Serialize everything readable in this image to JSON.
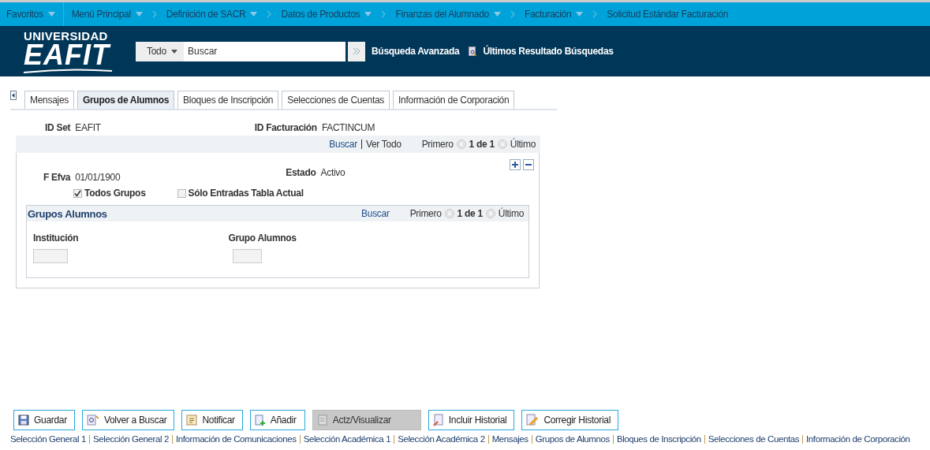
{
  "breadcrumb": [
    {
      "label": "Favoritos",
      "dropdown": true,
      "separator": false
    },
    {
      "label": "Menú Principal",
      "dropdown": true,
      "separator": false
    },
    {
      "label": "Definición de SACR",
      "dropdown": true,
      "separator": true
    },
    {
      "label": "Datos de Productos",
      "dropdown": true,
      "separator": true
    },
    {
      "label": "Finanzas del Alumnado",
      "dropdown": true,
      "separator": true
    },
    {
      "label": "Facturación",
      "dropdown": true,
      "separator": true
    },
    {
      "label": "Solicitud Estándar Facturación",
      "dropdown": false,
      "separator": true
    }
  ],
  "header": {
    "logo_top": "UNIVERSIDAD",
    "logo_main": "EAFIT",
    "scope": "Todo",
    "search_placeholder": "Buscar",
    "advanced_search": "Búsqueda Avanzada",
    "recent_results": "Últimos Resultado Búsquedas"
  },
  "tabs": [
    {
      "label": "Mensajes",
      "selected": false
    },
    {
      "label": "Grupos de Alumnos",
      "selected": true
    },
    {
      "label": "Bloques de Inscripción",
      "selected": false
    },
    {
      "label": "Selecciones de Cuentas",
      "selected": false
    },
    {
      "label": "Información de Corporación",
      "selected": false
    }
  ],
  "key_fields": [
    {
      "label": "ID Set",
      "value": "EAFIT"
    },
    {
      "label": "ID Facturación",
      "value": "FACTINCUM"
    }
  ],
  "nav_bar": {
    "find": "Buscar",
    "view_all": "Ver Todo",
    "first": "Primero",
    "count": "1 de 1",
    "last": "Último"
  },
  "effective": {
    "date_label": "F Efva",
    "date": "01/01/1900",
    "status_label": "Estado",
    "status": "Activo"
  },
  "checkboxes": [
    {
      "label": "Todos Grupos",
      "checked": true
    },
    {
      "label": "Sólo Entradas Tabla Actual",
      "checked": false
    }
  ],
  "groups": {
    "title": "Grupos Alumnos",
    "find": "Buscar",
    "first": "Primero",
    "count": "1 de 1",
    "last": "Último",
    "columns": [
      "Institución",
      "Grupo Alumnos"
    ]
  },
  "buttons": [
    {
      "label": "Guardar",
      "kind": "save",
      "disabled": false
    },
    {
      "label": "Volver a Buscar",
      "kind": "search",
      "disabled": false
    },
    {
      "label": "Notificar",
      "kind": "note",
      "disabled": false
    },
    {
      "label": "Añadir",
      "kind": "add",
      "disabled": false
    },
    {
      "label": "Actz/Visualizar",
      "kind": "doc",
      "disabled": true
    },
    {
      "label": "Incluir Historial",
      "kind": "history",
      "disabled": false
    },
    {
      "label": "Corregir Historial",
      "kind": "edit",
      "disabled": false
    }
  ],
  "footer_links": [
    "Selección General 1",
    "Selección General 2",
    "Información de Comunicaciones",
    "Selección Académica 1",
    "Selección Académica 2",
    "Mensajes",
    "Grupos de Alumnos",
    "Bloques de Inscripción",
    "Selecciones de Cuentas",
    "Información de Corporación"
  ]
}
